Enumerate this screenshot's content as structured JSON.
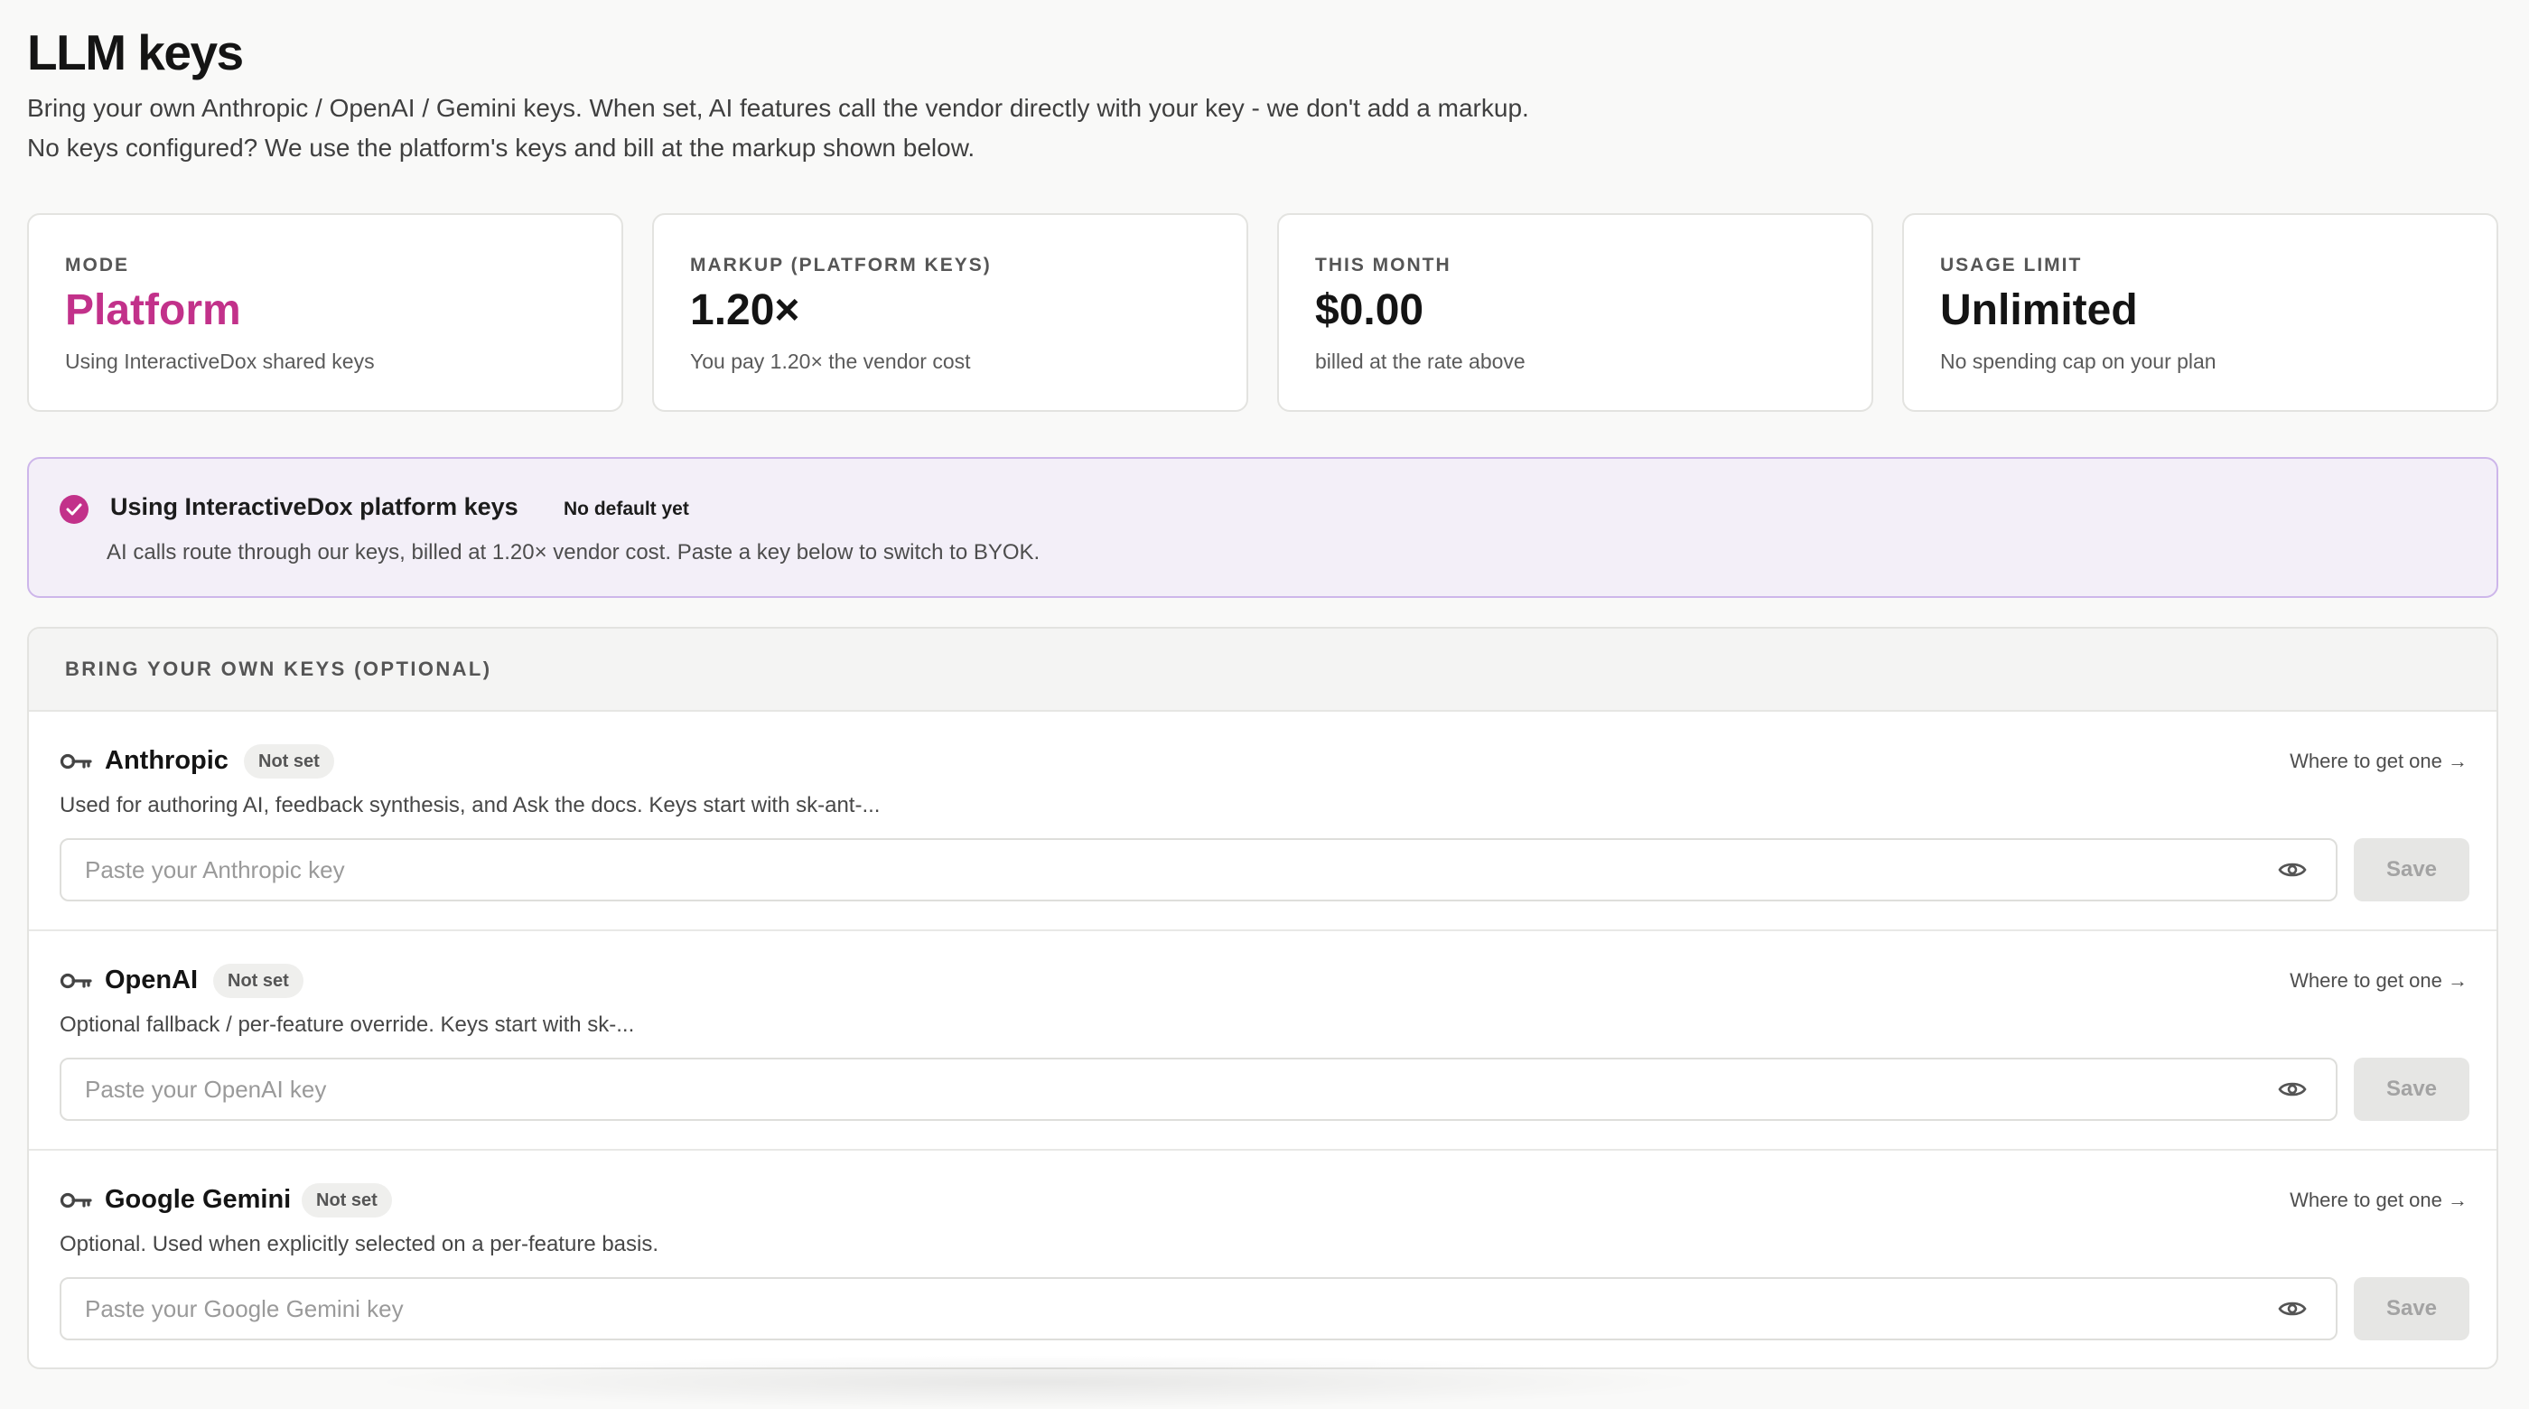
{
  "page": {
    "title": "LLM keys",
    "subtitle": "Bring your own Anthropic / OpenAI / Gemini keys. When set, AI features call the vendor directly with your key - we don't add a markup. No keys configured? We use the platform's keys and bill at the markup shown below."
  },
  "stats": [
    {
      "label": "MODE",
      "value": "Platform",
      "note": "Using InteractiveDox shared keys",
      "accent": true
    },
    {
      "label": "MARKUP (PLATFORM KEYS)",
      "value": "1.20×",
      "note": "You pay 1.20× the vendor cost"
    },
    {
      "label": "THIS MONTH",
      "value": "$0.00",
      "note": "billed at the rate above"
    },
    {
      "label": "USAGE LIMIT",
      "value": "Unlimited",
      "note": "No spending cap on your plan"
    }
  ],
  "banner": {
    "title": "Using InteractiveDox platform keys",
    "pill": "No default yet",
    "description": "AI calls route through our keys, billed at 1.20× vendor cost. Paste a key below to switch to BYOK."
  },
  "byok": {
    "section_label": "BRING YOUR OWN KEYS (OPTIONAL)",
    "providers": [
      {
        "name": "Anthropic",
        "status": "Not set",
        "where_link": "Where to get one →",
        "description": "Used for authoring AI, feedback synthesis, and Ask the docs. Keys start with sk-ant-...",
        "placeholder": "Paste your Anthropic key",
        "value": "",
        "save_label": "Save"
      },
      {
        "name": "OpenAI",
        "status": "Not set",
        "where_link": "Where to get one →",
        "description": "Optional fallback / per-feature override. Keys start with sk-...",
        "placeholder": "Paste your OpenAI key",
        "value": "",
        "save_label": "Save"
      },
      {
        "name": "Google Gemini",
        "status": "Not set",
        "where_link": "Where to get one →",
        "description": "Optional. Used when explicitly selected on a per-feature basis.",
        "placeholder": "Paste your Google Gemini key",
        "value": "",
        "save_label": "Save"
      }
    ]
  },
  "icons": {
    "banner": "check-circle-icon",
    "provider": "key-icon",
    "toggle": "eye-icon"
  },
  "colors": {
    "accent": "#c2318a",
    "banner_bg": "#f3eff8",
    "banner_border": "#cdb6ea"
  }
}
